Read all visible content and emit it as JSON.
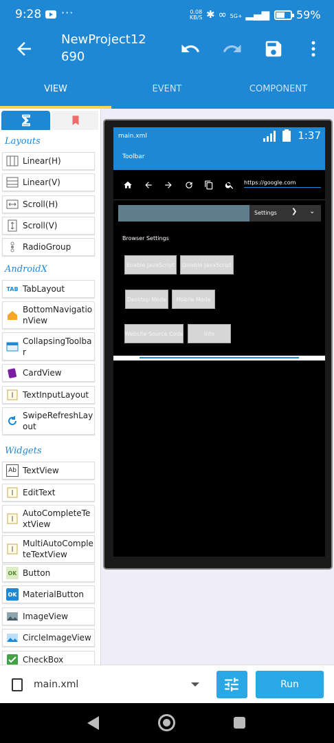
{
  "status_bar": {
    "time": "9:28",
    "dots": "···",
    "speed_value": "0.08",
    "speed_unit": "KB/S",
    "network": "5G+",
    "battery_pct": "59%",
    "icons": [
      "youtube-icon",
      "bluetooth-icon",
      "link-icon",
      "volte-icon",
      "signal-icon",
      "battery-icon"
    ]
  },
  "app_bar": {
    "title": "NewProject12",
    "subtitle": "690",
    "actions": [
      "undo-icon",
      "redo-icon",
      "save-icon",
      "more-icon"
    ]
  },
  "tabs": [
    {
      "label": "VIEW",
      "active": true
    },
    {
      "label": "EVENT",
      "active": false
    },
    {
      "label": "COMPONENT",
      "active": false
    }
  ],
  "palette": {
    "sections": {
      "layouts": "Layouts",
      "androidx": "AndroidX",
      "widgets": "Widgets"
    },
    "layouts": [
      {
        "label": "Linear(H)",
        "icon": "linear-h-icon"
      },
      {
        "label": "Linear(V)",
        "icon": "linear-v-icon"
      },
      {
        "label": "Scroll(H)",
        "icon": "scroll-h-icon"
      },
      {
        "label": "Scroll(V)",
        "icon": "scroll-v-icon"
      },
      {
        "label": "RadioGroup",
        "icon": "radiogroup-icon"
      }
    ],
    "androidx": [
      {
        "label": "TabLayout",
        "icon": "tab-icon"
      },
      {
        "label": "BottomNavigationView",
        "icon": "home-icon"
      },
      {
        "label": "CollapsingToolbar",
        "icon": "toolbar-icon"
      },
      {
        "label": "CardView",
        "icon": "cardview-icon"
      },
      {
        "label": "TextInputLayout",
        "icon": "textinput-icon"
      },
      {
        "label": "SwipeRefreshLayout",
        "icon": "refresh-icon"
      }
    ],
    "widgets": [
      {
        "label": "TextView",
        "icon": "textview-icon"
      },
      {
        "label": "EditText",
        "icon": "edittext-icon"
      },
      {
        "label": "AutoCompleteTextView",
        "icon": "autocomplete-icon"
      },
      {
        "label": "MultiAutoCompleteTextView",
        "icon": "multiautocomplete-icon"
      },
      {
        "label": "Button",
        "icon": "button-icon"
      },
      {
        "label": "MaterialButton",
        "icon": "materialbutton-icon"
      },
      {
        "label": "ImageView",
        "icon": "imageview-icon"
      },
      {
        "label": "CircleImageView",
        "icon": "circleimageview-icon"
      },
      {
        "label": "CheckBox",
        "icon": "checkbox-icon"
      }
    ],
    "colors": {
      "accent": "#1e88d4"
    }
  },
  "device": {
    "filename": "main.xml",
    "clock": "1:37",
    "toolbar_title": "Toolbar",
    "url": "https://google.com",
    "settings_label": "Settings",
    "browser_settings_title": "Browser Settings",
    "buttons": [
      "Enable JavaScript",
      "Disable JavaScript",
      "Desktop Mode",
      "Mobile Mode",
      "Website Source Code",
      "Info"
    ]
  },
  "bottom_bar": {
    "file": "main.xml",
    "run_label": "Run"
  }
}
